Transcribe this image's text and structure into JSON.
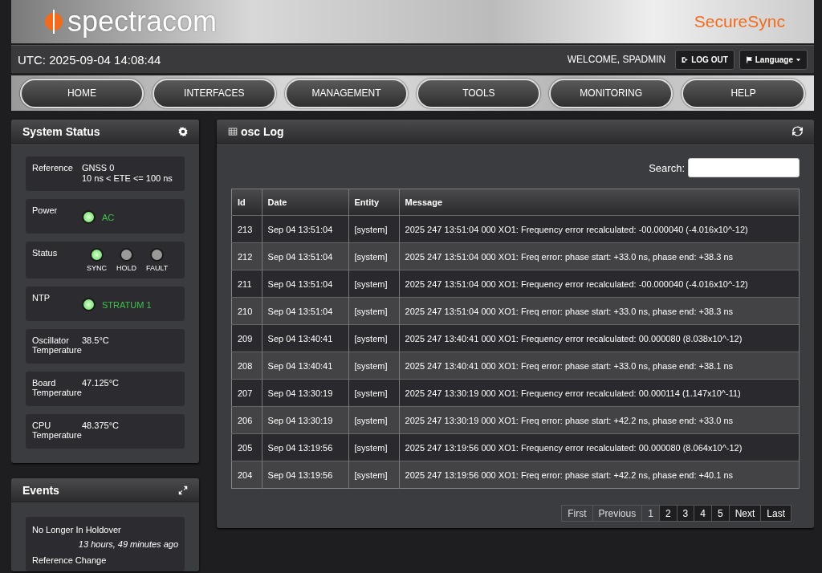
{
  "header": {
    "logo": "spectracom",
    "product": "SecureSync"
  },
  "topbar": {
    "utc": "UTC: 2025-09-04 14:08:44",
    "welcome": "WELCOME, SPADMIN",
    "logout": "LOG OUT",
    "language": "Language"
  },
  "nav": [
    "HOME",
    "INTERFACES",
    "MANAGEMENT",
    "TOOLS",
    "MONITORING",
    "HELP"
  ],
  "system_status": {
    "title": "System Status",
    "items": [
      {
        "kind": "text",
        "label": "Reference",
        "lines": [
          "GNSS 0",
          "10 ns < ETE <= 100 ns"
        ]
      },
      {
        "kind": "led",
        "label": "Power",
        "on": true,
        "value": "AC"
      },
      {
        "kind": "leds",
        "label": "Status",
        "leds": [
          {
            "label": "SYNC",
            "on": true
          },
          {
            "label": "HOLD",
            "on": false
          },
          {
            "label": "FAULT",
            "on": false
          }
        ]
      },
      {
        "kind": "led",
        "label": "NTP",
        "on": true,
        "value": "STRATUM 1"
      },
      {
        "kind": "text",
        "label": "Oscillator Temperature",
        "lines": [
          "38.5°C"
        ]
      },
      {
        "kind": "text",
        "label": "Board Temperature",
        "lines": [
          "47.125°C"
        ]
      },
      {
        "kind": "text",
        "label": "CPU Temperature",
        "lines": [
          "48.375°C"
        ]
      }
    ]
  },
  "events": {
    "title": "Events",
    "items": [
      {
        "name": "No Longer In Holdover",
        "time": "13 hours, 49 minutes ago"
      },
      {
        "name": "Reference Change"
      }
    ]
  },
  "log": {
    "title": "osc Log",
    "search_label": "Search:",
    "columns": [
      "Id",
      "Date",
      "Entity",
      "Message"
    ],
    "rows": [
      [
        "213",
        "Sep 04 13:51:04",
        "[system]",
        "2025 247 13:51:04 000 XO1: Frequency error recalculated: -00.000040 (-4.016x10^-12)"
      ],
      [
        "212",
        "Sep 04 13:51:04",
        "[system]",
        "2025 247 13:51:04 000 XO1: Freq error: phase start: +33.0 ns, phase end: +38.3 ns"
      ],
      [
        "211",
        "Sep 04 13:51:04",
        "[system]",
        "2025 247 13:51:04 000 XO1: Frequency error recalculated: -00.000040 (-4.016x10^-12)"
      ],
      [
        "210",
        "Sep 04 13:51:04",
        "[system]",
        "2025 247 13:51:04 000 XO1: Freq error: phase start: +33.0 ns, phase end: +38.3 ns"
      ],
      [
        "209",
        "Sep 04 13:40:41",
        "[system]",
        "2025 247 13:40:41 000 XO1: Frequency error recalculated: 00.000080 (8.038x10^-12)"
      ],
      [
        "208",
        "Sep 04 13:40:41",
        "[system]",
        "2025 247 13:40:41 000 XO1: Freq error: phase start: +33.0 ns, phase end: +38.1 ns"
      ],
      [
        "207",
        "Sep 04 13:30:19",
        "[system]",
        "2025 247 13:30:19 000 XO1: Frequency error recalculated: 00.000114 (1.147x10^-11)"
      ],
      [
        "206",
        "Sep 04 13:30:19",
        "[system]",
        "2025 247 13:30:19 000 XO1: Freq error: phase start: +42.2 ns, phase end: +33.0 ns"
      ],
      [
        "205",
        "Sep 04 13:19:56",
        "[system]",
        "2025 247 13:19:56 000 XO1: Frequency error recalculated: 00.000080 (8.064x10^-12)"
      ],
      [
        "204",
        "Sep 04 13:19:56",
        "[system]",
        "2025 247 13:19:56 000 XO1: Freq error: phase start: +42.2 ns, phase end: +40.1 ns"
      ]
    ],
    "pagination": [
      {
        "label": "First",
        "disabled": true
      },
      {
        "label": "Previous",
        "disabled": true
      },
      {
        "label": "1",
        "selected": true
      },
      {
        "label": "2",
        "selected": false
      },
      {
        "label": "3",
        "selected": false
      },
      {
        "label": "4",
        "selected": false
      },
      {
        "label": "5",
        "selected": false
      },
      {
        "label": "Next",
        "disabled": false
      },
      {
        "label": "Last",
        "disabled": false
      }
    ]
  }
}
